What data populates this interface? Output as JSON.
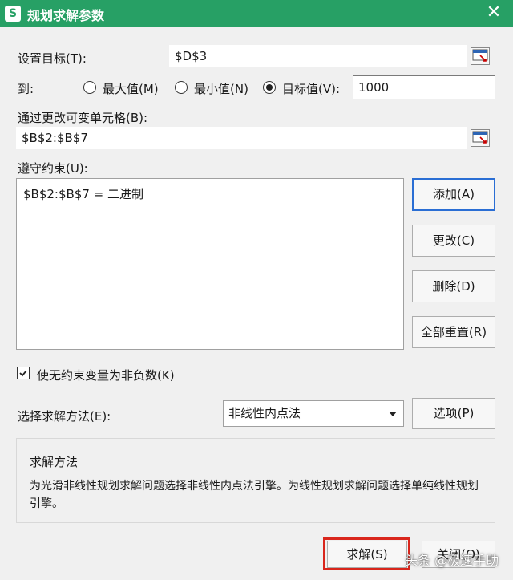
{
  "window": {
    "app_icon": "S",
    "title": "规划求解参数",
    "close_glyph": "✕"
  },
  "objective": {
    "label": "设置目标(T):",
    "value": "$D$3"
  },
  "to": {
    "label": "到:",
    "options": [
      {
        "label": "最大值(M)",
        "checked": false
      },
      {
        "label": "最小值(N)",
        "checked": false
      },
      {
        "label": "目标值(V):",
        "checked": true
      }
    ],
    "target_value": "1000"
  },
  "variables": {
    "label": "通过更改可变单元格(B):",
    "value": "$B$2:$B$7"
  },
  "constraints": {
    "label": "遵守约束(U):",
    "items": [
      "$B$2:$B$7 = 二进制"
    ]
  },
  "buttons": {
    "add": "添加(A)",
    "change": "更改(C)",
    "delete": "删除(D)",
    "reset_all": "全部重置(R)",
    "options": "选项(P)",
    "solve": "求解(S)",
    "close": "关闭(O)"
  },
  "nonnegative": {
    "label": "使无约束变量为非负数(K)",
    "checked": true
  },
  "method": {
    "label": "选择求解方法(E):",
    "selected": "非线性内点法"
  },
  "method_panel": {
    "title": "求解方法",
    "description": "为光滑非线性规划求解问题选择非线性内点法引擎。为线性规划求解问题选择单纯线性规划引擎。"
  },
  "watermark": "头条 @极速手助",
  "icons": {
    "picker": "range-select-icon",
    "dropdown": "chevron-down-icon",
    "check": "checkmark-icon"
  },
  "colors": {
    "titlebar": "#27a065",
    "focus_border": "#2a6ed4",
    "highlight": "#d9261c"
  }
}
